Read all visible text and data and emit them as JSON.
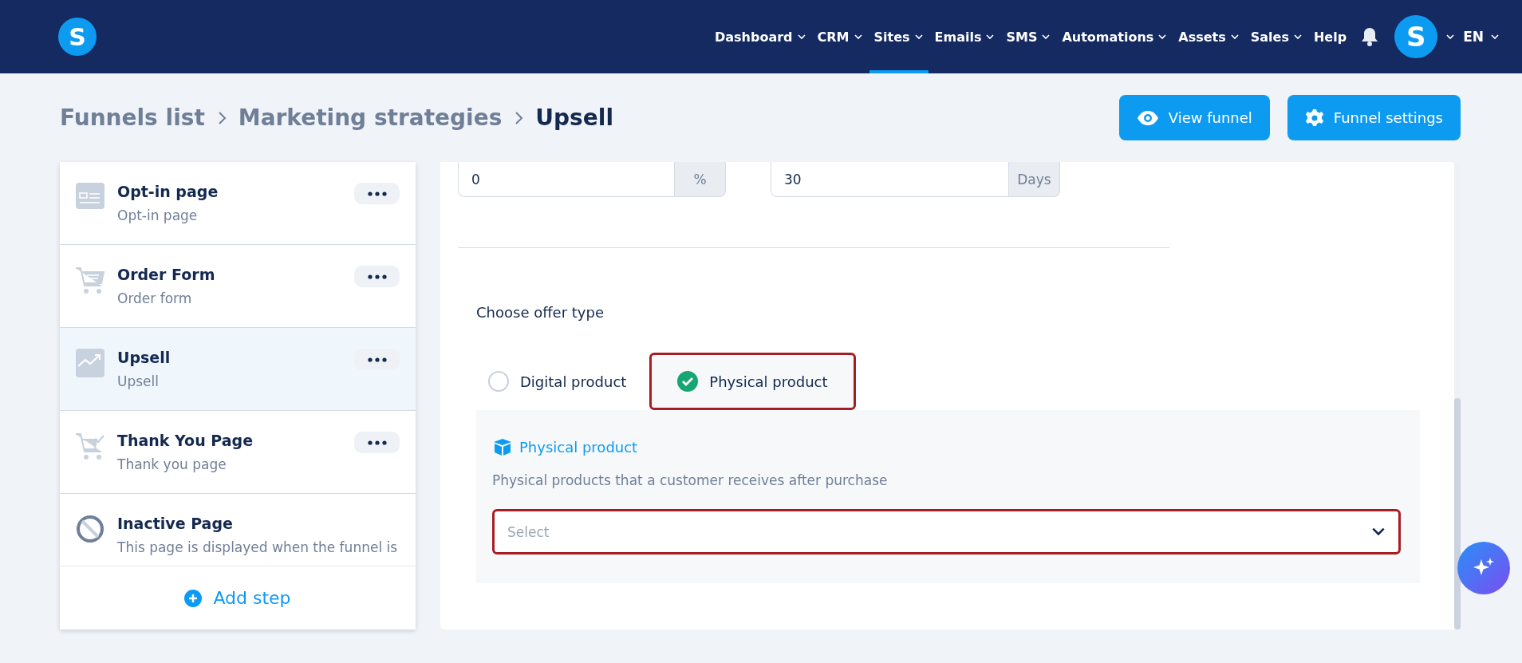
{
  "nav": {
    "items": [
      {
        "label": "Dashboard",
        "dropdown": true,
        "selected": false
      },
      {
        "label": "CRM",
        "dropdown": true,
        "selected": false
      },
      {
        "label": "Sites",
        "dropdown": true,
        "selected": true
      },
      {
        "label": "Emails",
        "dropdown": true,
        "selected": false
      },
      {
        "label": "SMS",
        "dropdown": true,
        "selected": false
      },
      {
        "label": "Automations",
        "dropdown": true,
        "selected": false
      },
      {
        "label": "Assets",
        "dropdown": true,
        "selected": false
      },
      {
        "label": "Sales",
        "dropdown": true,
        "selected": false
      },
      {
        "label": "Help",
        "dropdown": false,
        "selected": false
      }
    ],
    "avatar": "S",
    "logo": "S",
    "language": "EN"
  },
  "breadcrumb": [
    "Funnels list",
    "Marketing strategies",
    "Upsell"
  ],
  "actions": [
    {
      "kind": "view",
      "label": "View funnel"
    },
    {
      "kind": "settings",
      "label": "Funnel settings"
    }
  ],
  "steps": [
    {
      "kind": "optin",
      "title": "Opt-in page",
      "subtitle": "Opt-in page",
      "selected": false
    },
    {
      "kind": "order",
      "title": "Order Form",
      "subtitle": "Order form",
      "selected": false
    },
    {
      "kind": "upsell",
      "title": "Upsell",
      "subtitle": "Upsell",
      "selected": true
    },
    {
      "kind": "thanks",
      "title": "Thank You Page",
      "subtitle": "Thank you page",
      "selected": false
    },
    {
      "kind": "inactive",
      "title": "Inactive Page",
      "subtitle": "This page is displayed when the funnel is",
      "selected": false
    }
  ],
  "add_step": "Add step",
  "fields": [
    {
      "value": "0",
      "unit": "%"
    },
    {
      "value": "30",
      "unit": "Days"
    }
  ],
  "offer": {
    "label": "Choose offer type",
    "options": [
      {
        "label": "Digital product",
        "selected": false
      },
      {
        "label": "Physical product",
        "selected": true
      }
    ],
    "panel_title": "Physical product",
    "description": "Physical products that a customer receives after purchase",
    "select": {
      "placeholder": "Select",
      "highlighted": true
    }
  }
}
